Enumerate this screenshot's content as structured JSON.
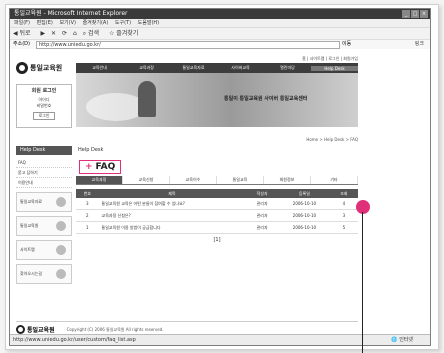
{
  "browser": {
    "title": "통일교육원 - Microsoft Internet Explorer",
    "menu": [
      "파일(F)",
      "편집(E)",
      "보기(V)",
      "즐겨찾기(A)",
      "도구(T)",
      "도움말(H)"
    ],
    "toolbar": [
      "뒤로",
      "앞으로",
      "중지",
      "새로고침",
      "홈",
      "검색",
      "즐겨찾기"
    ],
    "address_label": "주소(D)",
    "url": "http://www.uniedu.go.kr/",
    "go_label": "이동",
    "links_label": "링크",
    "status_text": "http://www.uniedu.go.kr/user/custom/faq_list.asp",
    "status_zone": "인터넷"
  },
  "site": {
    "logo_text": "통일교육원",
    "login_title": "회원 로그인",
    "login_lines": [
      "아이디",
      "비밀번호"
    ],
    "login_button": "로그인",
    "help_tab": "Help Desk",
    "side_items": [
      "FAQ",
      "묻고 답하기",
      "이용안내"
    ],
    "side_banners": [
      "통일교육자료",
      "통일교육원",
      "사이트맵",
      "찾아오시는길"
    ],
    "top_links": "홈 | 사이트맵 | 로그인 | 회원가입",
    "gnb": [
      "교육안내",
      "교육과정",
      "통일교육자료",
      "사이버교육",
      "열린마당",
      "Help Desk"
    ],
    "gnb_active": 5,
    "hero_text": "통일이 통일교육원 사이버 통일교육센터",
    "breadcrumb": "Home > Help Desk > FAQ",
    "section_label": "Help Desk",
    "page_title": "FAQ",
    "subtabs": [
      "교육과정",
      "교육신청",
      "교육이수",
      "통일교육",
      "회원정보",
      "기타"
    ],
    "subtab_active": 0,
    "table": {
      "headers": [
        "번호",
        "제목",
        "작성자",
        "등록일",
        "조회"
      ],
      "rows": [
        [
          "3",
          "통일교육원 교육은 어떤 분들이 참여할 수 있나요?",
          "관리자",
          "2006-10-10",
          "4"
        ],
        [
          "2",
          "교육과정 신청은?",
          "관리자",
          "2006-10-10",
          "3"
        ],
        [
          "1",
          "통일교육원 이용 방법이 궁금합니다",
          "관리자",
          "2006-10-10",
          "5"
        ]
      ]
    },
    "pager": "[1]",
    "footer_text": "Copyright (C) 2006 통일교육원 All rights reserved."
  },
  "colors": {
    "accent": "#e0307a",
    "nav_dark": "#3d3d3d"
  }
}
